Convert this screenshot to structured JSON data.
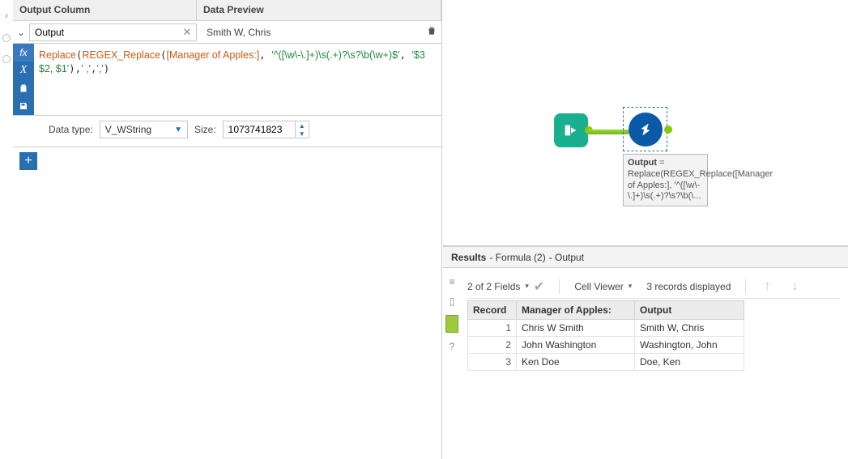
{
  "header": {
    "output_col": "Output Column",
    "preview_col": "Data Preview"
  },
  "editor": {
    "output_name": "Output",
    "preview_value": "Smith W, Chris",
    "formula_parts": {
      "fn_replace": "Replace",
      "fn_regex": "REGEX_Replace",
      "field": "[Manager of Apples:]",
      "pattern": "'^([\\w\\-\\.]+)\\s(.+)?\\s?\\b(\\w+)$'",
      "replace_with": "'$3 $2, $1'",
      "search": "' ,'",
      "replace_to": "','"
    },
    "data_type_label": "Data type:",
    "data_type_value": "V_WString",
    "size_label": "Size:",
    "size_value": "1073741823"
  },
  "canvas": {
    "tooltip_title": "Output",
    "tooltip_eq": " = Replace(REGEX_Replace([Manager of Apples:], '^([\\w\\-\\.]+)\\s(.+)?\\s?\\b(\\..."
  },
  "results": {
    "title": "Results",
    "subtitle_tool": " - Formula (2)",
    "subtitle_out": " - Output",
    "fields_label": "2 of 2 Fields",
    "cellviewer_label": "Cell Viewer",
    "records_label": "3 records displayed",
    "columns": {
      "record": "Record",
      "c1": "Manager of Apples:",
      "c2": "Output"
    },
    "rows": [
      {
        "rec": "1",
        "c1": "Chris W Smith",
        "c2": "Smith W, Chris"
      },
      {
        "rec": "2",
        "c1": "John Washington",
        "c2": "Washington, John"
      },
      {
        "rec": "3",
        "c1": "Ken Doe",
        "c2": "Doe, Ken"
      }
    ]
  }
}
